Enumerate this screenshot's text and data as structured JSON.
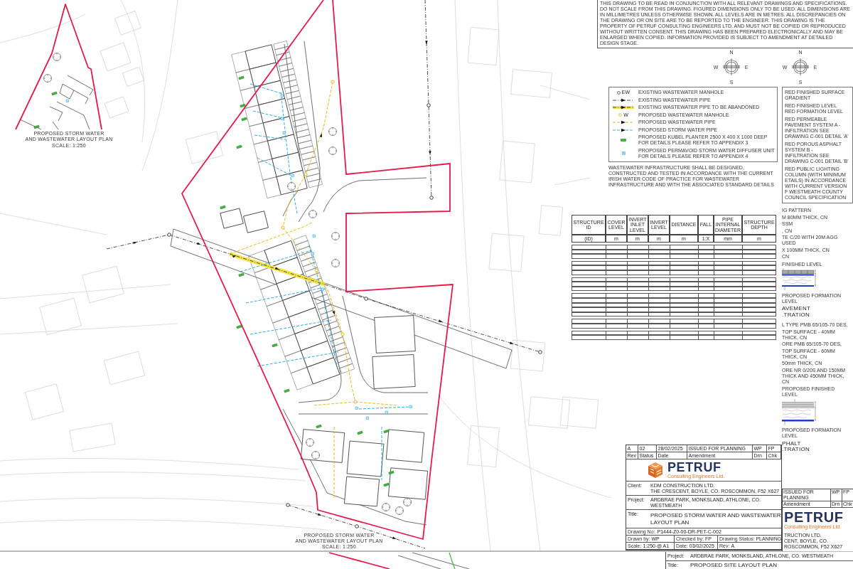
{
  "sheet_notes": {
    "text": "THIS DRAWING TO BE READ IN CONJUNCTION WITH ALL RELEVANT DRAWINGS AND SPECIFICATIONS. DO NOT SCALE FROM THIS DRAWING. FIGURED DIMENSIONS ONLY TO BE USED. ALL DIMENSIONS ARE IN MILLIMETRES UNLESS OTHERWISE SHOWN. ALL LEVELS ARE IN METRES. ALL DISCREPANCIES ON THE DRAWING OR ON SITE ARE TO BE REPORTED TO THE ENGINEER. THIS DRAWING IS THE PROPERTY OF PETRUF CONSULTING ENGINEERS LTD. AND MUST NOT BE COPIED OR REPRODUCED WITHOUT WRITTEN CONSENT. THIS DRAWING HAS BEEN PREPARED ELECTRONICALLY AND MAY BE ENLARGED WHEN COPIED. INFORMATION PROVIDED IS SUBJECT TO AMENDMENT AT DETAILED DESIGN STAGE."
  },
  "inset_plan": {
    "title_lines": [
      "PROPOSED STORM WATER",
      "AND WASTEWATER LAYOUT PLAN",
      "SCALE: 1:250"
    ]
  },
  "main_plan": {
    "title_lines": [
      "PROPOSED STORM WATER",
      "AND WASTEWATER LAYOUT PLAN",
      "SCALE: 1:250"
    ]
  },
  "compass_roses": [
    {
      "n": "N",
      "e": "E",
      "s": "S",
      "w": "W"
    },
    {
      "n": "N",
      "e": "E",
      "s": "S",
      "w": "W"
    }
  ],
  "legend": {
    "items": [
      {
        "kind": "existing-manhole",
        "tag": "EW",
        "label": "EXISTING WASTEWATER MANHOLE"
      },
      {
        "kind": "existing-pipe",
        "label": "EXISTING WASTEWATER PIPE"
      },
      {
        "kind": "abandoned-pipe",
        "label": "EXISTING WASTEWATER PIPE TO BE ABANDONED"
      },
      {
        "kind": "proposed-manhole",
        "tag": "W",
        "label": "PROPOSED WASTEWATER MANHOLE"
      },
      {
        "kind": "proposed-wastewater-pipe",
        "label": "PROPOSED WASTEWATER PIPE"
      },
      {
        "kind": "proposed-storm-pipe",
        "label": "PROPOSED STORM WATER PIPE"
      },
      {
        "kind": "planter",
        "label": "PROPOSED KUBEL PLANTER 2500 X 400 X 1000 DEEP FOR DETAILS PLEASE REFER TO APPENDIX 3"
      },
      {
        "kind": "diffuser",
        "label": "PROPOSED PERMAVOID STORM WATER DIFFUSER UNIT FOR DETAILS PLEASE REFER TO APPENDIX 4"
      }
    ],
    "note": "WASTEWATER INFRASTRUCTURE SHALL BE DESIGNED, CONSTRUCTED AND TESTED IN ACCORDANCE WITH THE CURRENT IRISH WATER CODE OF PRACTICE FOR WASTEWATER INFRASTRUCTURE AND WITH THE ASSOCIATED STANDARD DETAILS"
  },
  "key_notes": {
    "entries": [
      [
        "RED FINISHED SURFACE GRADIENT"
      ],
      [
        "RED FINISHED LEVEL",
        "RED FORMATION LEVEL"
      ],
      [
        "RED PERMEABLE PAVEMENT SYSTEM A -",
        "INFILTRATION SEE DRAWING C-001 DETAIL 'A'"
      ],
      [
        "RED POROUS ASPHALT SYSTEM B -",
        "INFILTRATION SEE DRAWING C-001 DETAIL 'B'"
      ],
      [
        "RED PUBLIC LIGHTING COLUMN (WITH MINIMUM",
        "ETAILS) IN ACCORDANCE WITH CURRENT VERSION",
        "F WESTMEATH COUNTY COUNCIL SPECIFICATION"
      ]
    ]
  },
  "structure_table": {
    "columns": [
      {
        "heading": "STRUCTURE ID",
        "unit": "(ID)"
      },
      {
        "heading": "COVER LEVEL",
        "unit": "m"
      },
      {
        "heading": "INVERT INLET LEVEL",
        "unit": "m"
      },
      {
        "heading": "INVERT LEVEL",
        "unit": "m"
      },
      {
        "heading": "DISTANCE",
        "unit": "m"
      },
      {
        "heading": "FALL",
        "unit": "1:X"
      },
      {
        "heading": "PIPE INTERNAL DIAMETER",
        "unit": "mm"
      },
      {
        "heading": "STRUCTURE DEPTH",
        "unit": "m"
      }
    ]
  },
  "details": [
    {
      "kind": "block-paving",
      "notes": [
        "IG PATTERN",
        "M 80MM THICK, CN",
        "SSM",
        ", CN",
        "TE C/20 WITH 20M AGG USED",
        "X 100MM THICK, CN",
        "CN"
      ],
      "top_label": "FINISHED LEVEL",
      "bottom_label": "PROPOSED FORMATION LEVEL",
      "heading_lines": [
        "AVEMENT",
        ".TRATION"
      ]
    },
    {
      "kind": "asphalt",
      "notes": [
        "L TYPE PMB 65/105-70 DES,",
        "TOP SURFACE - 40MM THICK, CN",
        "ORE PMB 65/105-70 DES,",
        "TOP SURFACE - 60MM THICK, CN",
        "50mm THICK, CN",
        "ORE NR 0/20S AND 150MM THICK AND 450MM THICK, CN"
      ],
      "top_label": "PROPOSED FINISHED LEVEL",
      "bottom_label": "PROPOSED FORMATION LEVEL",
      "heading_lines": [
        "PHALT",
        ".TRATION"
      ]
    }
  ],
  "title_block": {
    "revisions": [
      {
        "rev": "A",
        "status": "02",
        "date": "28/02/2025",
        "amendment": "ISSUED FOR PLANNING",
        "drawn": "WP",
        "checked": "FP"
      }
    ],
    "revision_headers": {
      "rev": "Rev",
      "status": "Status",
      "date": "Date",
      "amendment": "Amendment",
      "drawn": "Drn",
      "checked": "Chk"
    },
    "logo": {
      "name": "PETRUF",
      "tagline": "Consulting Engineers Ltd."
    },
    "client": {
      "label": "Client:",
      "lines": [
        "KDM CONSTRUCTION LTD.",
        "THE CRESCENT, BOYLE, CO. ROSCOMMON, F52 X627"
      ]
    },
    "project": {
      "label": "Project:",
      "value": "ARDBRAE PARK, MONKSLAND, ATHLONE, CO. WESTMEATH"
    },
    "title": {
      "label": "Title:",
      "value": "PROPOSED STORM WATER AND WASTEWATER LAYOUT PLAN"
    },
    "drawing_number": {
      "label": "Drawing No:",
      "value": "P1444-Z0-00-DR-PET-C-002"
    },
    "info_rows": [
      [
        {
          "label": "Drawn by:",
          "value": "WP"
        },
        {
          "label": "Checked by:",
          "value": "FP"
        },
        {
          "label": "Drawing Status:",
          "value": "PLANNING"
        }
      ],
      [
        {
          "label": "Scale:",
          "value": "1:250 @ A1"
        },
        {
          "label": "Date:",
          "value": "03/02/2025"
        },
        {
          "label": "Rev:",
          "value": "A"
        }
      ]
    ]
  },
  "underlying_title_block": {
    "revision": {
      "amendment": "ISSUED FOR PLANNING",
      "drawn": "WP",
      "checked": "FP"
    },
    "revision_headers": {
      "amendment": "Amendment",
      "drawn": "Drn",
      "checked": "Chk"
    },
    "logo": {
      "name": "PETRUF",
      "tagline": "Consulting Engineers Ltd."
    },
    "client_lines": [
      "TRUCTION LTD.",
      "CENT, BOYLE, CO. ROSCOMMON, F52 X627"
    ],
    "project": {
      "label": "Project:",
      "value": "ARDBRAE PARK, MONKSLAND, ATHLONE, CO. WESTMEATH"
    },
    "title": {
      "label": "Title:",
      "value": "PROPOSED SITE LAYOUT PLAN"
    }
  }
}
